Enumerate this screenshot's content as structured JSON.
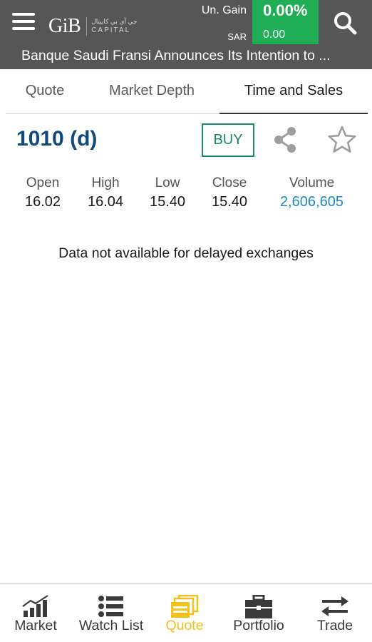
{
  "header": {
    "logo_mark": "GiB",
    "logo_arabic": "جي آي بي كابيتال",
    "logo_capital": "CAPITAL",
    "gain_label": "Un. Gain",
    "gain_currency": "SAR",
    "gain_value": "0.00%",
    "gain_amount": "0.00",
    "ticker": "Banque Saudi Fransi Announces Its Intention to ...",
    "colors": {
      "bar": "#565656",
      "gain": "#1fae55"
    }
  },
  "tabs": [
    {
      "label": "Quote"
    },
    {
      "label": "Market Depth"
    },
    {
      "label": "Time and Sales",
      "active": true
    }
  ],
  "symbol": {
    "code": "1010 (d)",
    "buy_label": "BUY",
    "share_icon": "share-icon",
    "favorite_icon": "star-icon"
  },
  "stats": [
    {
      "label": "Open",
      "value": "16.02"
    },
    {
      "label": "High",
      "value": "16.04"
    },
    {
      "label": "Low",
      "value": "15.40"
    },
    {
      "label": "Close",
      "value": "15.40"
    },
    {
      "label": "Volume",
      "value": "2,606,605"
    }
  ],
  "message": "Data not available for delayed exchanges",
  "bottom_nav": [
    {
      "label": "Market",
      "icon": "bar-chart-icon"
    },
    {
      "label": "Watch List",
      "icon": "list-icon"
    },
    {
      "label": "Quote",
      "icon": "quote-icon",
      "active": true
    },
    {
      "label": "Portfolio",
      "icon": "briefcase-icon"
    },
    {
      "label": "Trade",
      "icon": "swap-arrows-icon"
    }
  ],
  "accent_colors": {
    "active_nav": "#f2c21b",
    "symbol": "#11497e",
    "buy": "#1b8c6a",
    "volume": "#1b8bc2"
  }
}
